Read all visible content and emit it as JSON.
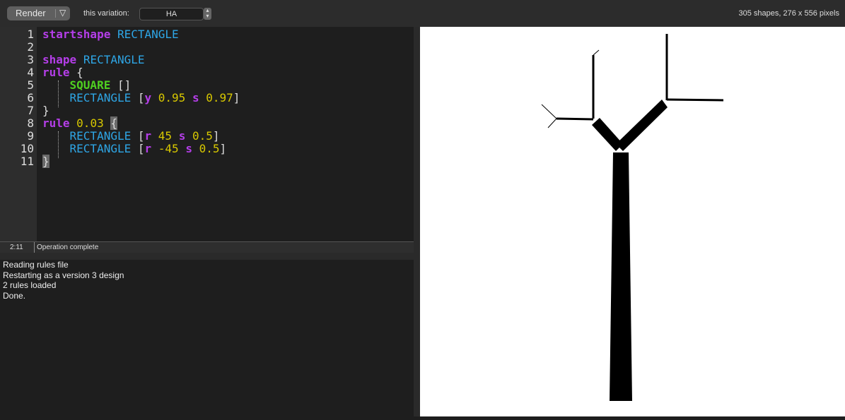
{
  "toolbar": {
    "render_label": "Render",
    "render_menu_icon": "▽",
    "variation_label": "this variation:",
    "variation_value": "HA",
    "stats": "305 shapes, 276 x 556 pixels"
  },
  "editor": {
    "lines": [
      [
        [
          "kw",
          "startshape"
        ],
        [
          "br",
          " "
        ],
        [
          "id",
          "RECTANGLE"
        ]
      ],
      [],
      [
        [
          "kw",
          "shape"
        ],
        [
          "br",
          " "
        ],
        [
          "id",
          "RECTANGLE"
        ]
      ],
      [
        [
          "kw",
          "rule"
        ],
        [
          "br",
          " {"
        ]
      ],
      [
        [
          "br",
          "    "
        ],
        [
          "sq",
          "SQUARE"
        ],
        [
          "br",
          " []"
        ]
      ],
      [
        [
          "br",
          "    "
        ],
        [
          "id",
          "RECTANGLE"
        ],
        [
          "br",
          " ["
        ],
        [
          "kw",
          "y"
        ],
        [
          "br",
          " "
        ],
        [
          "num",
          "0.95"
        ],
        [
          "br",
          " "
        ],
        [
          "kw",
          "s"
        ],
        [
          "br",
          " "
        ],
        [
          "num",
          "0.97"
        ],
        [
          "br",
          "]"
        ]
      ],
      [
        [
          "br",
          "}"
        ]
      ],
      [
        [
          "kw",
          "rule"
        ],
        [
          "br",
          " "
        ],
        [
          "num",
          "0.03"
        ],
        [
          "br",
          " "
        ],
        [
          "hl",
          "{"
        ]
      ],
      [
        [
          "br",
          "    "
        ],
        [
          "id",
          "RECTANGLE"
        ],
        [
          "br",
          " ["
        ],
        [
          "kw",
          "r"
        ],
        [
          "br",
          " "
        ],
        [
          "num",
          "45"
        ],
        [
          "br",
          " "
        ],
        [
          "kw",
          "s"
        ],
        [
          "br",
          " "
        ],
        [
          "num",
          "0.5"
        ],
        [
          "br",
          "]"
        ]
      ],
      [
        [
          "br",
          "    "
        ],
        [
          "id",
          "RECTANGLE"
        ],
        [
          "br",
          " ["
        ],
        [
          "kw",
          "r"
        ],
        [
          "br",
          " "
        ],
        [
          "num",
          "-45"
        ],
        [
          "br",
          " "
        ],
        [
          "kw",
          "s"
        ],
        [
          "br",
          " "
        ],
        [
          "num",
          "0.5"
        ],
        [
          "br",
          "]"
        ]
      ],
      [
        [
          "hl",
          "}"
        ]
      ]
    ]
  },
  "status": {
    "position": "2:11",
    "message": "Operation complete"
  },
  "console": {
    "lines": [
      "Reading rules file",
      "Restarting as a version 3 design",
      "2 rules loaded",
      "Done."
    ]
  }
}
